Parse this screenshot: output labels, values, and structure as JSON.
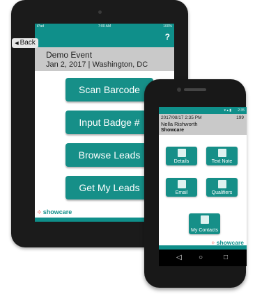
{
  "tablet": {
    "status": {
      "left": "iPad",
      "time": "7:00 AM",
      "battery": "100%"
    },
    "back_label": "Back",
    "help_label": "?",
    "event_name": "Demo Event",
    "event_date": "Jan 2, 2017 | Washington, DC",
    "buttons": [
      "Scan Barcode",
      "Input Badge #",
      "Browse Leads",
      "Get My Leads"
    ],
    "logo_text": "showcare"
  },
  "phone": {
    "status_time": "2:35",
    "datetime": "2017/08/17 2:35 PM",
    "count": "199",
    "name": "Nella Rishworth",
    "company": "Showcare",
    "tiles": [
      "Details",
      "Text Note",
      "Email",
      "Qualifiers",
      "My Contacts"
    ],
    "logo_text": "showcare",
    "nav": {
      "back": "◁",
      "home": "○",
      "recent": "□"
    }
  },
  "colors": {
    "teal": "#0f8f8a",
    "button_teal": "#168f88",
    "header_gray": "#c9c9c9",
    "logo_dot": "#ee3b2e"
  },
  "icons": [
    "back-arrow-icon",
    "help-icon",
    "details-icon",
    "text-note-icon",
    "email-icon",
    "qualifiers-icon",
    "contacts-icon",
    "showcare-logo-icon"
  ]
}
